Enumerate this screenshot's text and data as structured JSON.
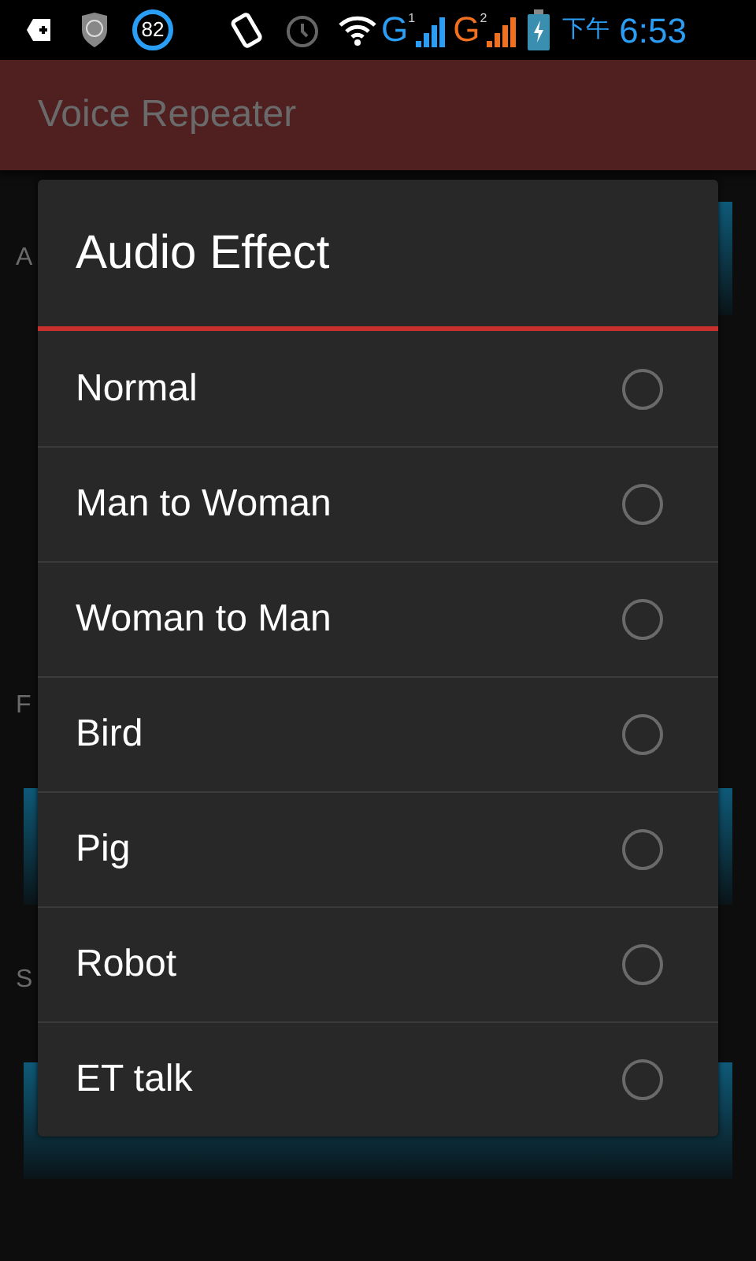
{
  "status_bar": {
    "battery_badge": "82",
    "network_1": "G",
    "sim_1": "1",
    "network_2": "G",
    "sim_2": "2",
    "period": "下午",
    "time": "6:53"
  },
  "app_bar": {
    "title": "Voice Repeater"
  },
  "background_sections": [
    {
      "label": "A"
    },
    {
      "label": "F"
    },
    {
      "label": "S"
    }
  ],
  "dialog": {
    "title": "Audio Effect",
    "options": [
      {
        "label": "Normal",
        "selected": false
      },
      {
        "label": "Man to Woman",
        "selected": false
      },
      {
        "label": "Woman to Man",
        "selected": false
      },
      {
        "label": "Bird",
        "selected": false
      },
      {
        "label": "Pig",
        "selected": false
      },
      {
        "label": "Robot",
        "selected": false
      },
      {
        "label": "ET talk",
        "selected": false
      }
    ]
  }
}
